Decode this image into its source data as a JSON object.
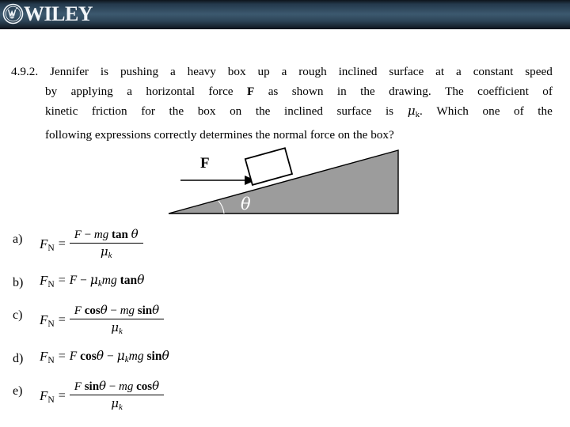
{
  "header": {
    "brand": "WILEY",
    "emblem_name": "wiley-circle-emblem",
    "background_color": "#2d4457"
  },
  "question": {
    "number": "4.9.2.",
    "lines": [
      "4.9.2. Jennifer is pushing a heavy box up a rough inclined surface at a constant speed",
      "by applying a horizontal force F as shown in the drawing.  The coefficient of",
      "kinetic friction for the box on the inclined surface is μk.  Which one of the",
      "following expressions correctly determines the normal force on the box?"
    ],
    "line1_words": [
      "4.9.2.",
      "Jennifer",
      "is",
      "pushing",
      "a",
      "heavy",
      "box",
      "up",
      "a",
      "rough",
      "inclined",
      "surface",
      "at",
      "a",
      "constant",
      "speed"
    ],
    "line2_words": [
      "by",
      "applying",
      "a",
      "horizontal",
      "force",
      "F",
      "as",
      "shown",
      "in",
      "the",
      "drawing.",
      "The",
      "coefficient",
      "of"
    ],
    "line3_words": [
      "kinetic",
      "friction",
      "for",
      "the",
      "box",
      "on",
      "the",
      "inclined",
      "surface",
      "is",
      "μk.",
      "Which",
      "one",
      "of",
      "the"
    ],
    "line4": "following expressions correctly determines the normal force on the box?"
  },
  "diagram": {
    "name": "inclined-plane-with-box",
    "force_label": "F",
    "angle_label": "θ",
    "incline_fill": "#9c9c9c",
    "incline_stroke": "#000000",
    "box_fill": "#ffffff",
    "arrow_color": "#000000"
  },
  "options": [
    {
      "label": "a)",
      "lhs": "F",
      "lhs_sub": "N",
      "eq": "=",
      "type": "fraction",
      "numerator": "F − mg tan θ",
      "denominator": "μk",
      "num_parts": {
        "f": "F",
        "minus": "−",
        "mg": "mg",
        "trig": "tan",
        "angle": "θ"
      },
      "den_parts": {
        "mu": "μ",
        "sub": "k"
      }
    },
    {
      "label": "b)",
      "lhs": "F",
      "lhs_sub": "N",
      "eq": "=",
      "type": "inline",
      "expression": "F − μkmg tan θ",
      "parts": {
        "f": "F",
        "minus": "−",
        "mu": "μ",
        "sub": "k",
        "mg": "mg",
        "trig": "tan",
        "angle": "θ"
      }
    },
    {
      "label": "c)",
      "lhs": "F",
      "lhs_sub": "N",
      "eq": "=",
      "type": "fraction",
      "numerator": "F cos θ − mg sin θ",
      "denominator": "μk",
      "num_parts": {
        "f": "F",
        "trig1": "cos",
        "angle1": "θ",
        "minus": "−",
        "mg": "mg",
        "trig2": "sin",
        "angle2": "θ"
      },
      "den_parts": {
        "mu": "μ",
        "sub": "k"
      }
    },
    {
      "label": "d)",
      "lhs": "F",
      "lhs_sub": "N",
      "eq": "=",
      "type": "inline",
      "expression": "F cos θ − μkmg sin θ",
      "parts": {
        "f": "F",
        "trig1": "cos",
        "angle1": "θ",
        "minus": "−",
        "mu": "μ",
        "sub": "k",
        "mg": "mg",
        "trig2": "sin",
        "angle2": "θ"
      }
    },
    {
      "label": "e)",
      "lhs": "F",
      "lhs_sub": "N",
      "eq": "=",
      "type": "fraction",
      "numerator": "F sin θ − mg cos θ",
      "denominator": "μk",
      "num_parts": {
        "f": "F",
        "trig1": "sin",
        "angle1": "θ",
        "minus": "−",
        "mg": "mg",
        "trig2": "cos",
        "angle2": "θ"
      },
      "den_parts": {
        "mu": "μ",
        "sub": "k"
      }
    }
  ]
}
